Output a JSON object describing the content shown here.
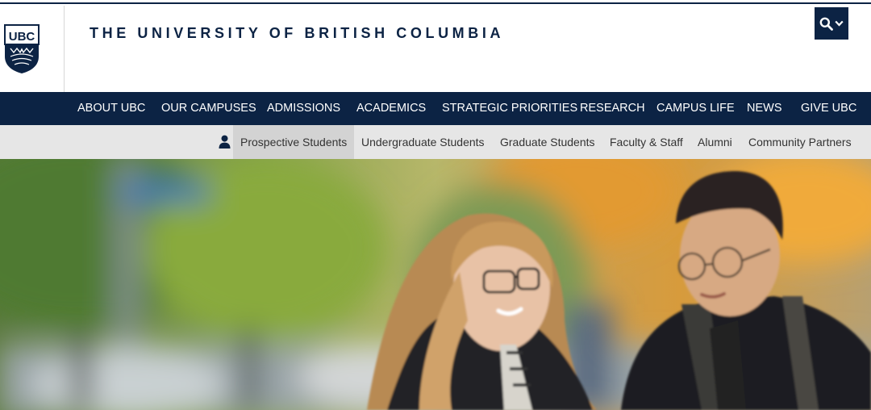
{
  "header": {
    "logo_alt": "UBC",
    "logo_text": "UBC",
    "wordmark": "THE UNIVERSITY OF BRITISH COLUMBIA",
    "search_icon": "search-icon",
    "chevron_icon": "chevron-down-icon"
  },
  "main_nav": [
    {
      "label": "ABOUT UBC"
    },
    {
      "label": "OUR CAMPUSES"
    },
    {
      "label": "ADMISSIONS"
    },
    {
      "label": "ACADEMICS"
    },
    {
      "label": "STRATEGIC PRIORITIES"
    },
    {
      "label": "RESEARCH"
    },
    {
      "label": "CAMPUS LIFE"
    },
    {
      "label": "NEWS"
    },
    {
      "label": "GIVE UBC"
    }
  ],
  "audience_nav": {
    "icon": "person-icon",
    "items": [
      {
        "label": "Prospective Students",
        "active": true
      },
      {
        "label": "Undergraduate Students"
      },
      {
        "label": "Graduate Students"
      },
      {
        "label": "Faculty & Staff"
      },
      {
        "label": "Alumni"
      },
      {
        "label": "Community Partners"
      }
    ]
  },
  "colors": {
    "brand_navy": "#0c2344",
    "subnav_bg": "#e6e6e6",
    "subnav_active_bg": "#d3d3d3"
  }
}
